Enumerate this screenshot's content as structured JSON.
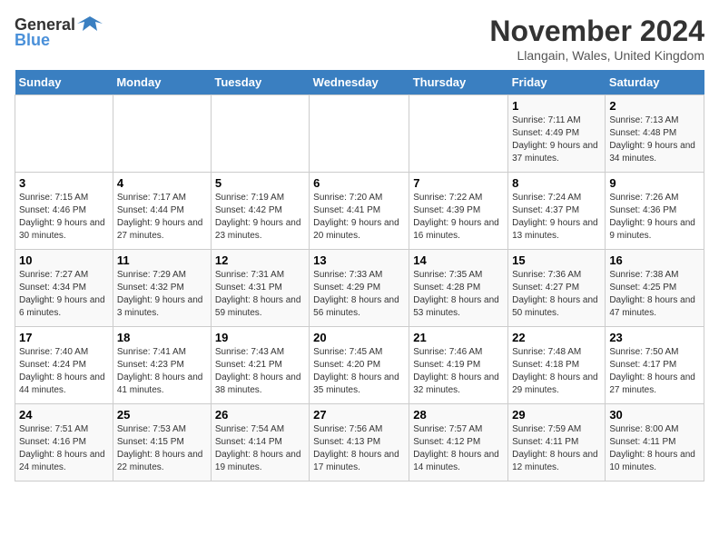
{
  "logo": {
    "text_general": "General",
    "text_blue": "Blue"
  },
  "title": {
    "month": "November 2024",
    "location": "Llangain, Wales, United Kingdom"
  },
  "weekdays": [
    "Sunday",
    "Monday",
    "Tuesday",
    "Wednesday",
    "Thursday",
    "Friday",
    "Saturday"
  ],
  "weeks": [
    [
      {
        "day": "",
        "info": ""
      },
      {
        "day": "",
        "info": ""
      },
      {
        "day": "",
        "info": ""
      },
      {
        "day": "",
        "info": ""
      },
      {
        "day": "",
        "info": ""
      },
      {
        "day": "1",
        "info": "Sunrise: 7:11 AM\nSunset: 4:49 PM\nDaylight: 9 hours and 37 minutes."
      },
      {
        "day": "2",
        "info": "Sunrise: 7:13 AM\nSunset: 4:48 PM\nDaylight: 9 hours and 34 minutes."
      }
    ],
    [
      {
        "day": "3",
        "info": "Sunrise: 7:15 AM\nSunset: 4:46 PM\nDaylight: 9 hours and 30 minutes."
      },
      {
        "day": "4",
        "info": "Sunrise: 7:17 AM\nSunset: 4:44 PM\nDaylight: 9 hours and 27 minutes."
      },
      {
        "day": "5",
        "info": "Sunrise: 7:19 AM\nSunset: 4:42 PM\nDaylight: 9 hours and 23 minutes."
      },
      {
        "day": "6",
        "info": "Sunrise: 7:20 AM\nSunset: 4:41 PM\nDaylight: 9 hours and 20 minutes."
      },
      {
        "day": "7",
        "info": "Sunrise: 7:22 AM\nSunset: 4:39 PM\nDaylight: 9 hours and 16 minutes."
      },
      {
        "day": "8",
        "info": "Sunrise: 7:24 AM\nSunset: 4:37 PM\nDaylight: 9 hours and 13 minutes."
      },
      {
        "day": "9",
        "info": "Sunrise: 7:26 AM\nSunset: 4:36 PM\nDaylight: 9 hours and 9 minutes."
      }
    ],
    [
      {
        "day": "10",
        "info": "Sunrise: 7:27 AM\nSunset: 4:34 PM\nDaylight: 9 hours and 6 minutes."
      },
      {
        "day": "11",
        "info": "Sunrise: 7:29 AM\nSunset: 4:32 PM\nDaylight: 9 hours and 3 minutes."
      },
      {
        "day": "12",
        "info": "Sunrise: 7:31 AM\nSunset: 4:31 PM\nDaylight: 8 hours and 59 minutes."
      },
      {
        "day": "13",
        "info": "Sunrise: 7:33 AM\nSunset: 4:29 PM\nDaylight: 8 hours and 56 minutes."
      },
      {
        "day": "14",
        "info": "Sunrise: 7:35 AM\nSunset: 4:28 PM\nDaylight: 8 hours and 53 minutes."
      },
      {
        "day": "15",
        "info": "Sunrise: 7:36 AM\nSunset: 4:27 PM\nDaylight: 8 hours and 50 minutes."
      },
      {
        "day": "16",
        "info": "Sunrise: 7:38 AM\nSunset: 4:25 PM\nDaylight: 8 hours and 47 minutes."
      }
    ],
    [
      {
        "day": "17",
        "info": "Sunrise: 7:40 AM\nSunset: 4:24 PM\nDaylight: 8 hours and 44 minutes."
      },
      {
        "day": "18",
        "info": "Sunrise: 7:41 AM\nSunset: 4:23 PM\nDaylight: 8 hours and 41 minutes."
      },
      {
        "day": "19",
        "info": "Sunrise: 7:43 AM\nSunset: 4:21 PM\nDaylight: 8 hours and 38 minutes."
      },
      {
        "day": "20",
        "info": "Sunrise: 7:45 AM\nSunset: 4:20 PM\nDaylight: 8 hours and 35 minutes."
      },
      {
        "day": "21",
        "info": "Sunrise: 7:46 AM\nSunset: 4:19 PM\nDaylight: 8 hours and 32 minutes."
      },
      {
        "day": "22",
        "info": "Sunrise: 7:48 AM\nSunset: 4:18 PM\nDaylight: 8 hours and 29 minutes."
      },
      {
        "day": "23",
        "info": "Sunrise: 7:50 AM\nSunset: 4:17 PM\nDaylight: 8 hours and 27 minutes."
      }
    ],
    [
      {
        "day": "24",
        "info": "Sunrise: 7:51 AM\nSunset: 4:16 PM\nDaylight: 8 hours and 24 minutes."
      },
      {
        "day": "25",
        "info": "Sunrise: 7:53 AM\nSunset: 4:15 PM\nDaylight: 8 hours and 22 minutes."
      },
      {
        "day": "26",
        "info": "Sunrise: 7:54 AM\nSunset: 4:14 PM\nDaylight: 8 hours and 19 minutes."
      },
      {
        "day": "27",
        "info": "Sunrise: 7:56 AM\nSunset: 4:13 PM\nDaylight: 8 hours and 17 minutes."
      },
      {
        "day": "28",
        "info": "Sunrise: 7:57 AM\nSunset: 4:12 PM\nDaylight: 8 hours and 14 minutes."
      },
      {
        "day": "29",
        "info": "Sunrise: 7:59 AM\nSunset: 4:11 PM\nDaylight: 8 hours and 12 minutes."
      },
      {
        "day": "30",
        "info": "Sunrise: 8:00 AM\nSunset: 4:11 PM\nDaylight: 8 hours and 10 minutes."
      }
    ]
  ]
}
